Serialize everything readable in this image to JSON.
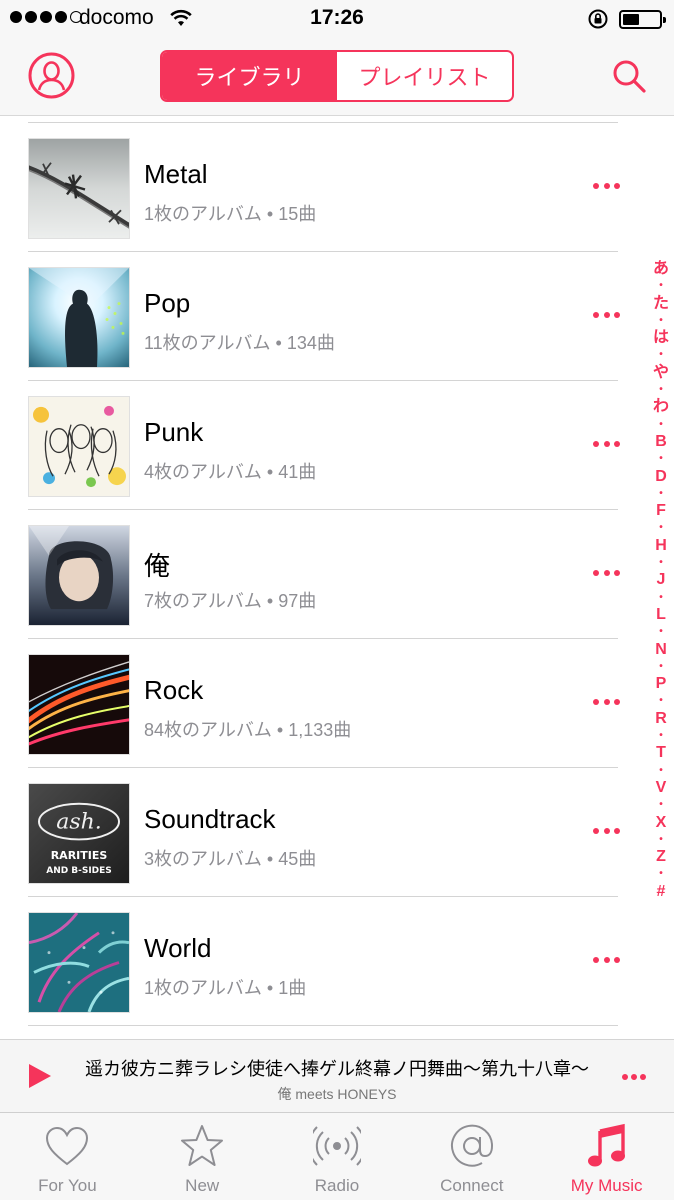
{
  "status_bar": {
    "carrier": "docomo",
    "time": "17:26",
    "signal_bars": 4,
    "signal_max": 5,
    "battery_level": 0.45
  },
  "nav": {
    "segments": [
      "ライブラリ",
      "プレイリスト"
    ],
    "active_segment": 0
  },
  "genres": [
    {
      "name": "Metal",
      "albums": "1枚のアルバム",
      "songs": "15曲",
      "art": "barbed-wire"
    },
    {
      "name": "Pop",
      "albums": "11枚のアルバム",
      "songs": "134曲",
      "art": "silhouette-light"
    },
    {
      "name": "Punk",
      "albums": "4枚のアルバム",
      "songs": "41曲",
      "art": "illustrated-faces"
    },
    {
      "name": "俺",
      "albums": "7枚のアルバム",
      "songs": "97曲",
      "art": "portrait-dark"
    },
    {
      "name": "Rock",
      "albums": "84枚のアルバム",
      "songs": "1,133曲",
      "art": "light-streaks"
    },
    {
      "name": "Soundtrack",
      "albums": "3枚のアルバム",
      "songs": "45曲",
      "art": "ash-rarities"
    },
    {
      "name": "World",
      "albums": "1枚のアルバム",
      "songs": "1曲",
      "art": "feather-pattern"
    }
  ],
  "art_text": {
    "ash_logo": "ash.",
    "ash_line1": "RARITIES",
    "ash_line2": "AND B-SIDES"
  },
  "separator": "•",
  "index": [
    "あ",
    "た",
    "は",
    "や",
    "わ",
    "B",
    "D",
    "F",
    "H",
    "J",
    "L",
    "N",
    "P",
    "R",
    "T",
    "V",
    "X",
    "Z",
    "#"
  ],
  "now_playing": {
    "title": "遥カ彼方ニ葬ラレシ使徒へ捧ゲル終幕ノ円舞曲〜第九十八章〜",
    "artist": "俺 meets HONEYS",
    "progress": 0.005
  },
  "tabs": [
    {
      "label": "For You",
      "icon": "heart-icon"
    },
    {
      "label": "New",
      "icon": "star-icon"
    },
    {
      "label": "Radio",
      "icon": "radio-icon"
    },
    {
      "label": "Connect",
      "icon": "at-icon"
    },
    {
      "label": "My Music",
      "icon": "music-note-icon"
    }
  ],
  "active_tab": 4,
  "colors": {
    "accent": "#f5345b",
    "secondary_text": "#8e8e93",
    "bar_background": "#f7f7f7"
  }
}
